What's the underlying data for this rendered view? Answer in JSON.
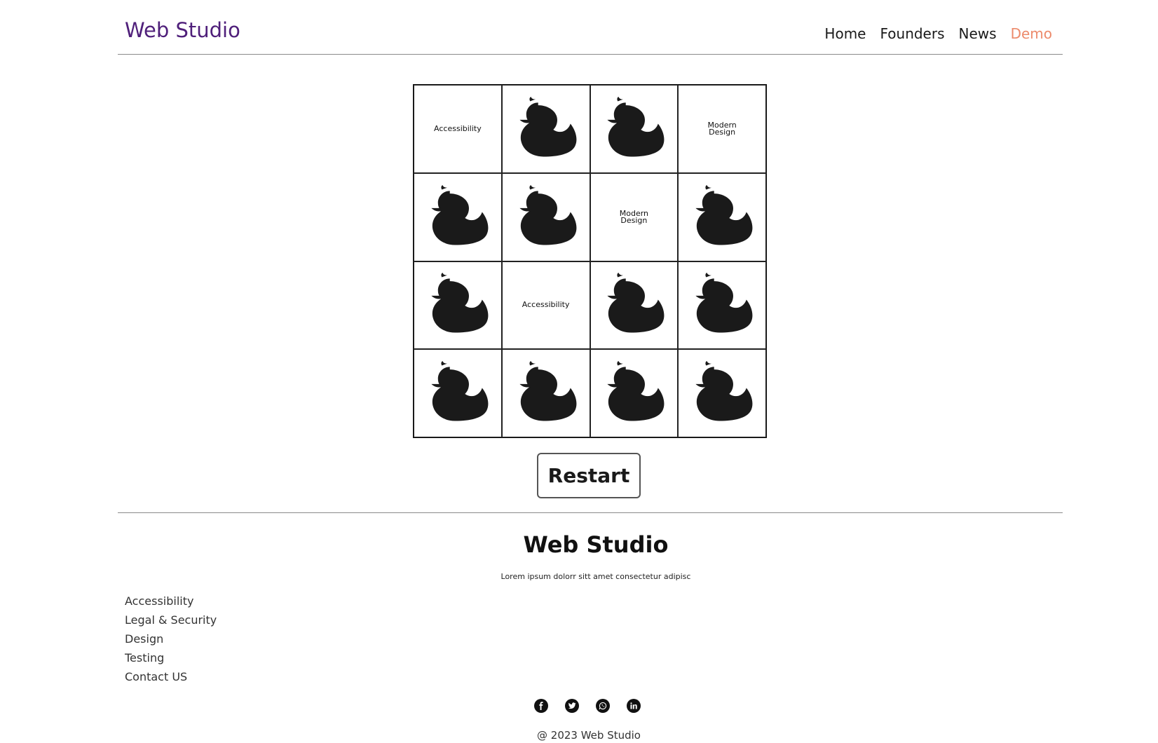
{
  "header": {
    "brand": "Web Studio",
    "nav": [
      {
        "label": "Home",
        "active": false
      },
      {
        "label": "Founders",
        "active": false
      },
      {
        "label": "News",
        "active": false
      },
      {
        "label": "Demo",
        "active": true
      }
    ]
  },
  "game": {
    "cells": [
      {
        "type": "text",
        "text": "Accessibility"
      },
      {
        "type": "duck",
        "icon": "duck-icon"
      },
      {
        "type": "duck",
        "icon": "duck-icon"
      },
      {
        "type": "text",
        "text": "Modern\nDesign"
      },
      {
        "type": "duck",
        "icon": "duck-icon"
      },
      {
        "type": "duck",
        "icon": "duck-icon"
      },
      {
        "type": "text",
        "text": "Modern\nDesign"
      },
      {
        "type": "duck",
        "icon": "duck-icon"
      },
      {
        "type": "duck",
        "icon": "duck-icon"
      },
      {
        "type": "text",
        "text": "Accessibility"
      },
      {
        "type": "duck",
        "icon": "duck-icon"
      },
      {
        "type": "duck",
        "icon": "duck-icon"
      },
      {
        "type": "duck",
        "icon": "duck-icon"
      },
      {
        "type": "duck",
        "icon": "duck-icon"
      },
      {
        "type": "duck",
        "icon": "duck-icon"
      },
      {
        "type": "duck",
        "icon": "duck-icon"
      }
    ],
    "restart_label": "Restart"
  },
  "footer": {
    "title": "Web Studio",
    "description": "Lorem ipsum dolorr sitt amet consectetur adipisc",
    "links": [
      "Accessibility",
      "Legal & Security",
      "Design",
      "Testing",
      "Contact US"
    ],
    "socials": [
      "facebook-icon",
      "twitter-icon",
      "whatsapp-icon",
      "linkedin-icon"
    ],
    "copyright": "@ 2023 Web Studio"
  },
  "colors": {
    "brand": "#4f1f7a",
    "nav_active": "#ec8a6b",
    "duck": "#1a1a1a"
  }
}
